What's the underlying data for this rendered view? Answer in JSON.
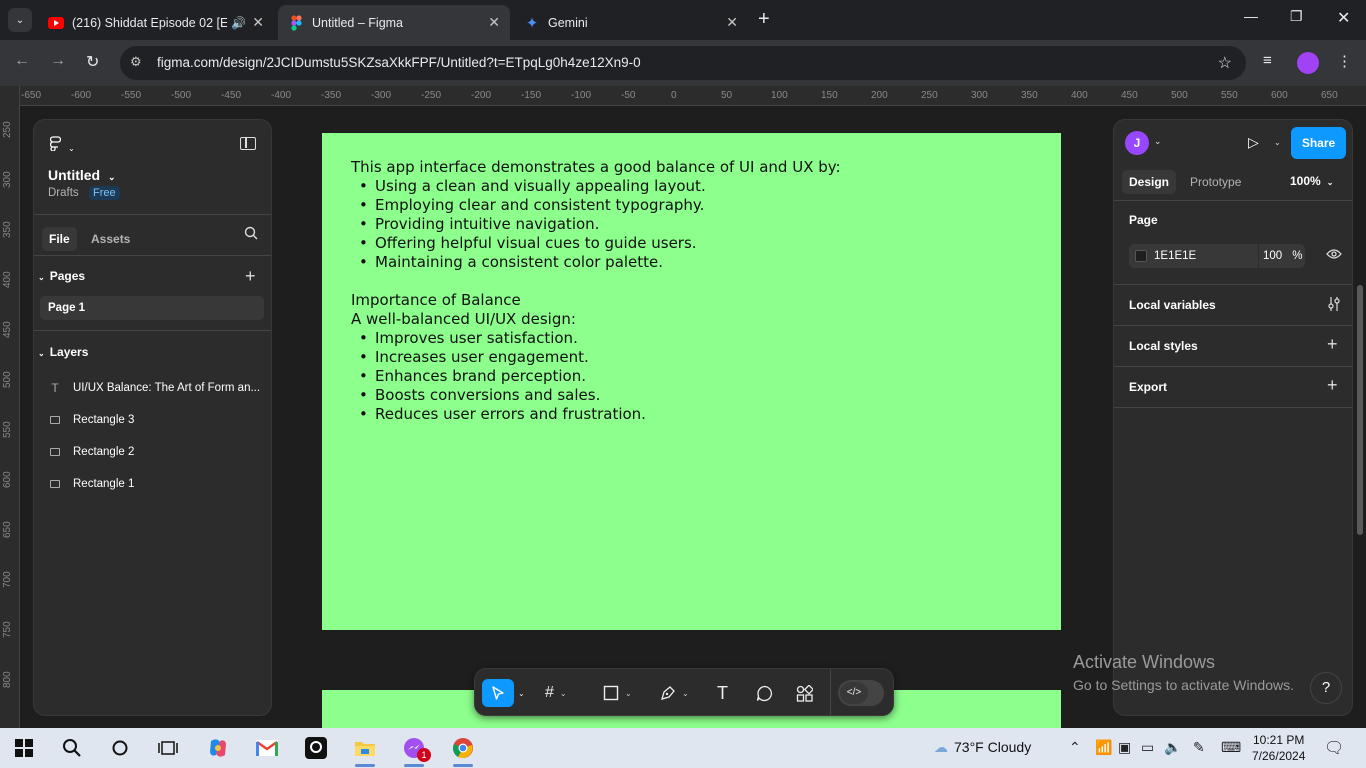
{
  "browser": {
    "tabs": [
      {
        "title": "(216) Shiddat Episode 02 [E",
        "icon": "youtube-icon",
        "audio": true
      },
      {
        "title": "Untitled – Figma",
        "icon": "figma-icon",
        "active": true
      },
      {
        "title": "Gemini",
        "icon": "gemini-icon"
      }
    ],
    "url": "figma.com/design/2JCIDumstu5SKZsaXkkFPF/Untitled?t=ETpqLg0h4ze12Xn9-0"
  },
  "rulers": {
    "horizontal": [
      "-650",
      "-600",
      "-550",
      "-500",
      "-450",
      "-400",
      "-350",
      "-300",
      "-250",
      "-200",
      "-150",
      "-100",
      "-50",
      "0",
      "50",
      "100",
      "150",
      "200",
      "250",
      "300",
      "350",
      "400",
      "450",
      "500",
      "550",
      "600",
      "650"
    ],
    "vertical": [
      "250",
      "300",
      "350",
      "400",
      "450",
      "500",
      "550",
      "600",
      "650",
      "700",
      "750",
      "800"
    ]
  },
  "left_panel": {
    "file_title": "Untitled",
    "drafts": "Drafts",
    "plan_badge": "Free",
    "tabs": [
      "File",
      "Assets"
    ],
    "pages_label": "Pages",
    "pages": [
      "Page 1"
    ],
    "layers_label": "Layers",
    "layers": [
      {
        "name": "UI/UX Balance: The Art of Form an...",
        "type": "text"
      },
      {
        "name": "Rectangle 3",
        "type": "rectangle"
      },
      {
        "name": "Rectangle 2",
        "type": "rectangle"
      },
      {
        "name": "Rectangle 1",
        "type": "rectangle"
      }
    ]
  },
  "canvas": {
    "intro": "This app interface demonstrates a good balance of UI and UX by:",
    "bullets1": [
      "Using a clean and visually appealing layout.",
      "Employing clear and consistent typography.",
      "Providing intuitive navigation.",
      "Offering helpful visual cues to guide users.",
      "Maintaining a consistent color palette."
    ],
    "heading2": "Importance of Balance",
    "intro2": "A well-balanced UI/UX design:",
    "bullets2": [
      "Improves user satisfaction.",
      "Increases user engagement.",
      "Enhances brand perception.",
      "Boosts conversions and sales.",
      "Reduces user errors and frustration."
    ],
    "artboard_color": "#8CFF8C"
  },
  "right_panel": {
    "avatar_initial": "J",
    "share_label": "Share",
    "tabs": [
      "Design",
      "Prototype"
    ],
    "zoom": "100%",
    "page_label": "Page",
    "page_color": "1E1E1E",
    "page_opacity": "100",
    "opacity_unit": "%",
    "local_variables": "Local variables",
    "local_styles": "Local styles",
    "export": "Export"
  },
  "watermark": {
    "line1": "Activate Windows",
    "line2": "Go to Settings to activate Windows."
  },
  "help": "?",
  "taskbar": {
    "weather": "73°F  Cloudy",
    "time": "10:21 PM",
    "date": "7/26/2024",
    "notification_badge": "1"
  }
}
